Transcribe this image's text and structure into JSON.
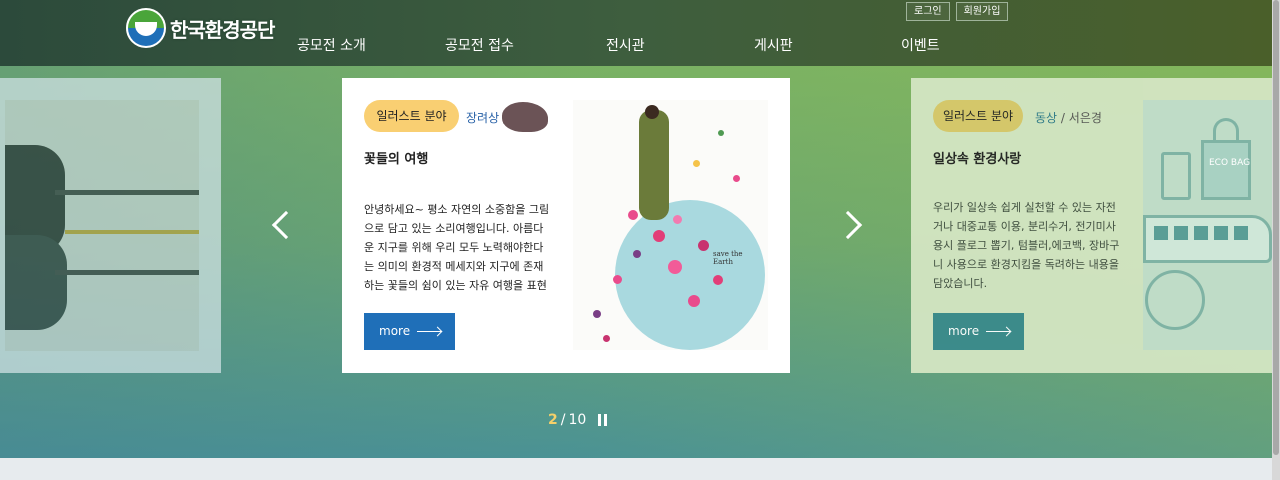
{
  "site": {
    "logo_text": "한국환경공단"
  },
  "util": {
    "login": "로그인",
    "signup": "회원가입"
  },
  "gnb": [
    {
      "label": "공모전 소개"
    },
    {
      "label": "공모전 접수"
    },
    {
      "label": "전시관"
    },
    {
      "label": "게시판"
    },
    {
      "label": "이벤트"
    }
  ],
  "slides": {
    "center": {
      "category": "일러스트 분야",
      "award": "장려상",
      "separator": "/",
      "title": "꽃들의 여행",
      "description": "안녕하세요~ 평소 자연의 소중함을 그림으로 담고 있는 소리여행입니다. 아름다운 지구를 위해 우리 모두 노력해야한다는 의미의 환경적 메세지와 지구에 존재하는 꽃들의 쉼이 있는 자유 여행을 표현",
      "more": "more",
      "illustration_text": "save the Earth"
    },
    "right": {
      "category": "일러스트 분야",
      "award": "동상",
      "separator": "/",
      "author": "서은경",
      "title": "일상속 환경사랑",
      "description": "우리가 일상속 쉽게 실천할 수 있는 자전거나 대중교통 이용, 분리수거, 전기미사용시 플로그 뽑기, 텀블러,에코백, 장바구니 사용으로 환경지킴을 독려하는 내용을 담았습니다.",
      "more": "more",
      "bag_text": "ECO BAG"
    }
  },
  "pager": {
    "current": "2",
    "separator": "/",
    "total": "10"
  },
  "colors": {
    "pill": "#f9cf72",
    "pill_side": "#d9c96b",
    "more_btn": "#1f6fb8",
    "more_btn_side": "#3a8a8c",
    "award": "#2a63a8"
  },
  "icons": {
    "prev": "chevron-left-icon",
    "next": "chevron-right-icon",
    "pause": "pause-icon"
  }
}
